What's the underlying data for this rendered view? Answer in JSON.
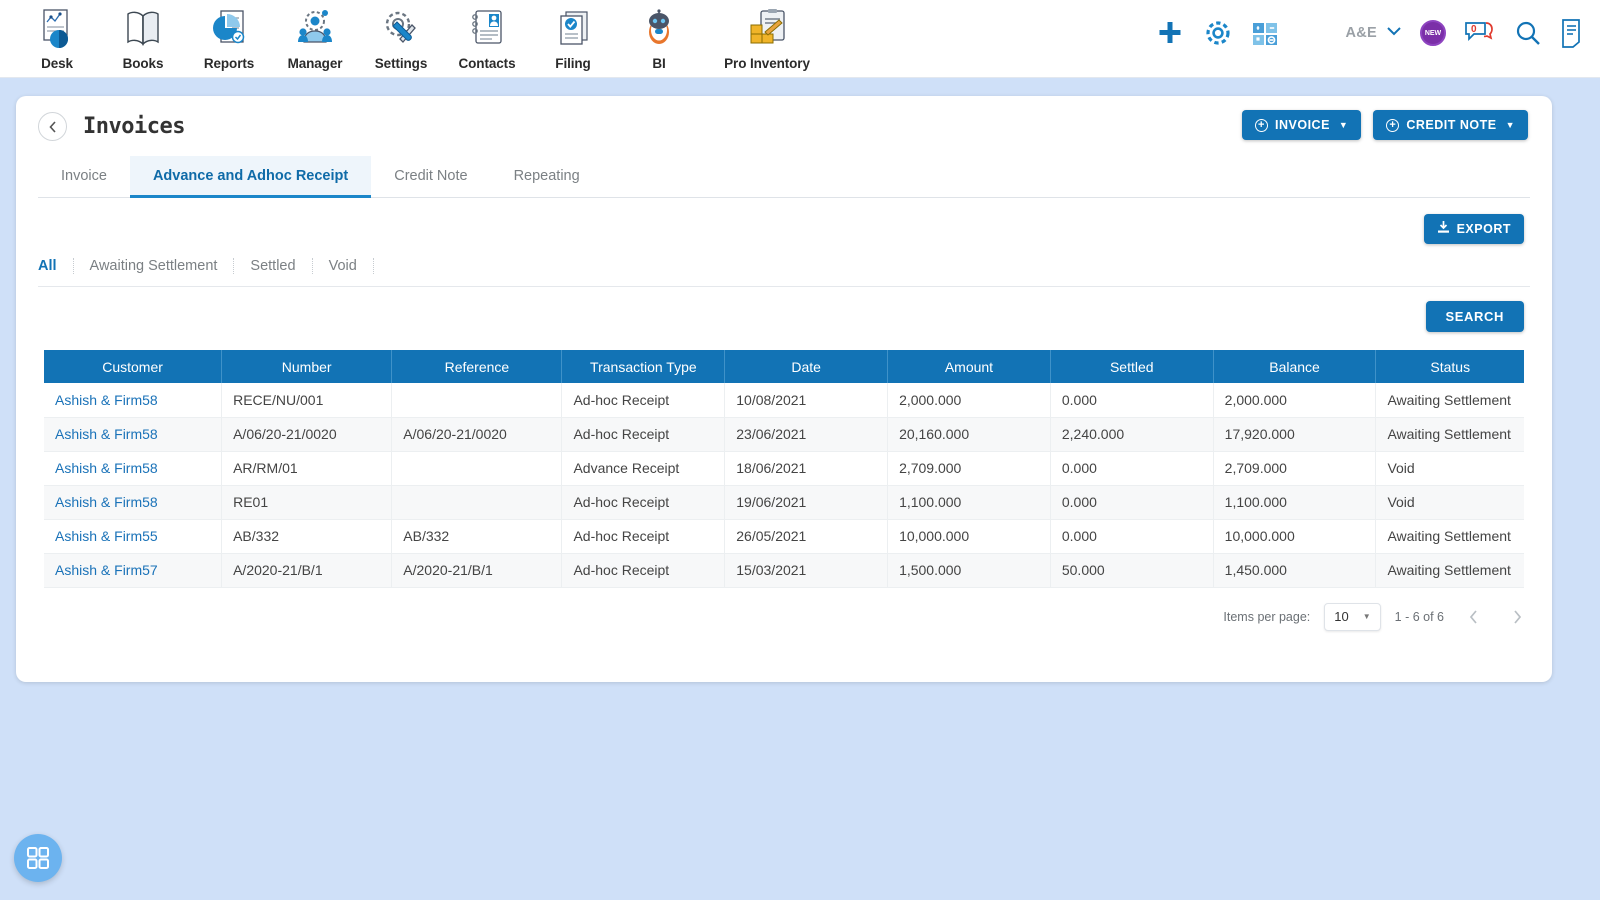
{
  "topnav": {
    "modules": [
      {
        "label": "Desk",
        "icon": "desk-chart-icon"
      },
      {
        "label": "Books",
        "icon": "open-book-icon"
      },
      {
        "label": "Reports",
        "icon": "pie-report-icon"
      },
      {
        "label": "Manager",
        "icon": "manager-gear-person-icon"
      },
      {
        "label": "Settings",
        "icon": "gear-wrench-icon"
      },
      {
        "label": "Contacts",
        "icon": "contacts-card-icon"
      },
      {
        "label": "Filing",
        "icon": "filing-check-doc-icon"
      },
      {
        "label": "BI",
        "icon": "robot-bi-icon"
      },
      {
        "label": "Pro Inventory",
        "icon": "inventory-clipboard-icon"
      }
    ],
    "actions": {
      "add": "add-plus-icon",
      "settings": "gear-icon",
      "calculator": "calculator-icon",
      "org_name": "A&E",
      "org_caret": "chevron-down-icon",
      "new_badge": "NEW",
      "chat_icon": "chat-bubble-icon",
      "chat_count": "0",
      "search": "search-icon",
      "notes": "notes-doc-icon"
    }
  },
  "page": {
    "back_icon": "chevron-left-icon",
    "title": "Invoices",
    "buttons": {
      "invoice": "INVOICE",
      "credit_note": "CREDIT NOTE",
      "export": "EXPORT",
      "search": "SEARCH"
    },
    "tabs": [
      {
        "label": "Invoice",
        "active": false
      },
      {
        "label": "Advance and Adhoc Receipt",
        "active": true
      },
      {
        "label": "Credit Note",
        "active": false
      },
      {
        "label": "Repeating",
        "active": false
      }
    ],
    "filters": [
      {
        "label": "All",
        "active": true
      },
      {
        "label": "Awaiting Settlement",
        "active": false
      },
      {
        "label": "Settled",
        "active": false
      },
      {
        "label": "Void",
        "active": false
      }
    ]
  },
  "table": {
    "columns": [
      "Customer",
      "Number",
      "Reference",
      "Transaction Type",
      "Date",
      "Amount",
      "Settled",
      "Balance",
      "Status"
    ],
    "rows": [
      {
        "customer": "Ashish & Firm58",
        "number": "RECE/NU/001",
        "reference": "",
        "transaction_type": "Ad-hoc Receipt",
        "date": "10/08/2021",
        "amount": "2,000.000",
        "settled": "0.000",
        "balance": "2,000.000",
        "status": "Awaiting Settlement"
      },
      {
        "customer": "Ashish & Firm58",
        "number": "A/06/20-21/0020",
        "reference": "A/06/20-21/0020",
        "transaction_type": "Ad-hoc Receipt",
        "date": "23/06/2021",
        "amount": "20,160.000",
        "settled": "2,240.000",
        "balance": "17,920.000",
        "status": "Awaiting Settlement"
      },
      {
        "customer": "Ashish & Firm58",
        "number": "AR/RM/01",
        "reference": "",
        "transaction_type": "Advance Receipt",
        "date": "18/06/2021",
        "amount": "2,709.000",
        "settled": "0.000",
        "balance": "2,709.000",
        "status": "Void"
      },
      {
        "customer": "Ashish & Firm58",
        "number": "RE01",
        "reference": "",
        "transaction_type": "Ad-hoc Receipt",
        "date": "19/06/2021",
        "amount": "1,100.000",
        "settled": "0.000",
        "balance": "1,100.000",
        "status": "Void"
      },
      {
        "customer": "Ashish & Firm55",
        "number": "AB/332",
        "reference": "AB/332",
        "transaction_type": "Ad-hoc Receipt",
        "date": "26/05/2021",
        "amount": "10,000.000",
        "settled": "0.000",
        "balance": "10,000.000",
        "status": "Awaiting Settlement"
      },
      {
        "customer": "Ashish & Firm57",
        "number": "A/2020-21/B/1",
        "reference": "A/2020-21/B/1",
        "transaction_type": "Ad-hoc Receipt",
        "date": "15/03/2021",
        "amount": "1,500.000",
        "settled": "50.000",
        "balance": "1,450.000",
        "status": "Awaiting Settlement"
      }
    ]
  },
  "paginator": {
    "items_per_page_label": "Items per page:",
    "items_per_page_value": "10",
    "range_label": "1 - 6 of 6",
    "prev_icon": "chevron-left-icon",
    "next_icon": "chevron-right-icon"
  },
  "fab": {
    "icon": "grid-apps-icon"
  },
  "colors": {
    "accent": "#1273b5",
    "page_bg": "#cfe0f8",
    "link": "#1a72b8",
    "tab_active_bg": "#eef5fb",
    "fab": "#6cb3ef",
    "badge_purple": "#7b2fa8",
    "chat_red": "#e03b2f"
  }
}
